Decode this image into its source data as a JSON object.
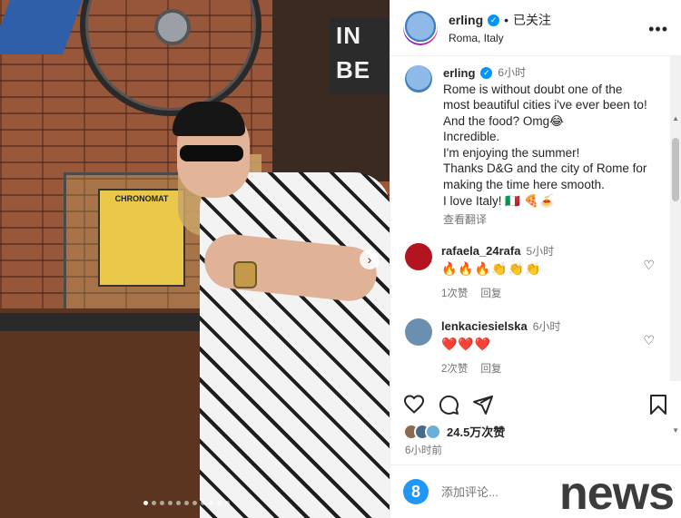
{
  "header": {
    "username": "erling",
    "separator": "•",
    "follow_status": "已关注",
    "location": "Roma, Italy",
    "more_label": "•••"
  },
  "photo": {
    "sign_text": "IN BE VERI",
    "poster_text": "CHRONOMAT",
    "next_label": "›",
    "dot_count": 11,
    "active_dot": 0
  },
  "caption": {
    "username": "erling",
    "time": "6小时",
    "text": "Rome is without doubt one of the most beautiful cities i've ever been to! And the food? Omg😂\nIncredible.\nI'm enjoying the summer!\nThanks D&G and the city of Rome for making the time here smooth.\nI love Italy! 🇮🇹 🍕🍝",
    "translate": "查看翻译"
  },
  "comments": [
    {
      "username": "rafaela_24rafa",
      "time": "5小时",
      "text": "🔥🔥🔥👏👏👏",
      "likes": "1次赞",
      "reply": "回复",
      "avatar_color": "#b3141f"
    },
    {
      "username": "lenkaciesielska",
      "time": "6小时",
      "text": "❤️❤️❤️",
      "likes": "2次赞",
      "reply": "回复",
      "avatar_color": "#6a8fb0"
    }
  ],
  "actions": {
    "like_icon": "heart-icon",
    "comment_icon": "comment-icon",
    "share_icon": "share-icon",
    "save_icon": "bookmark-icon"
  },
  "likes": {
    "count_text": "24.5万次赞"
  },
  "post_time": "6小时前",
  "add_comment": {
    "emoji_label": "8",
    "placeholder": "添加评论..."
  },
  "watermark": "news"
}
